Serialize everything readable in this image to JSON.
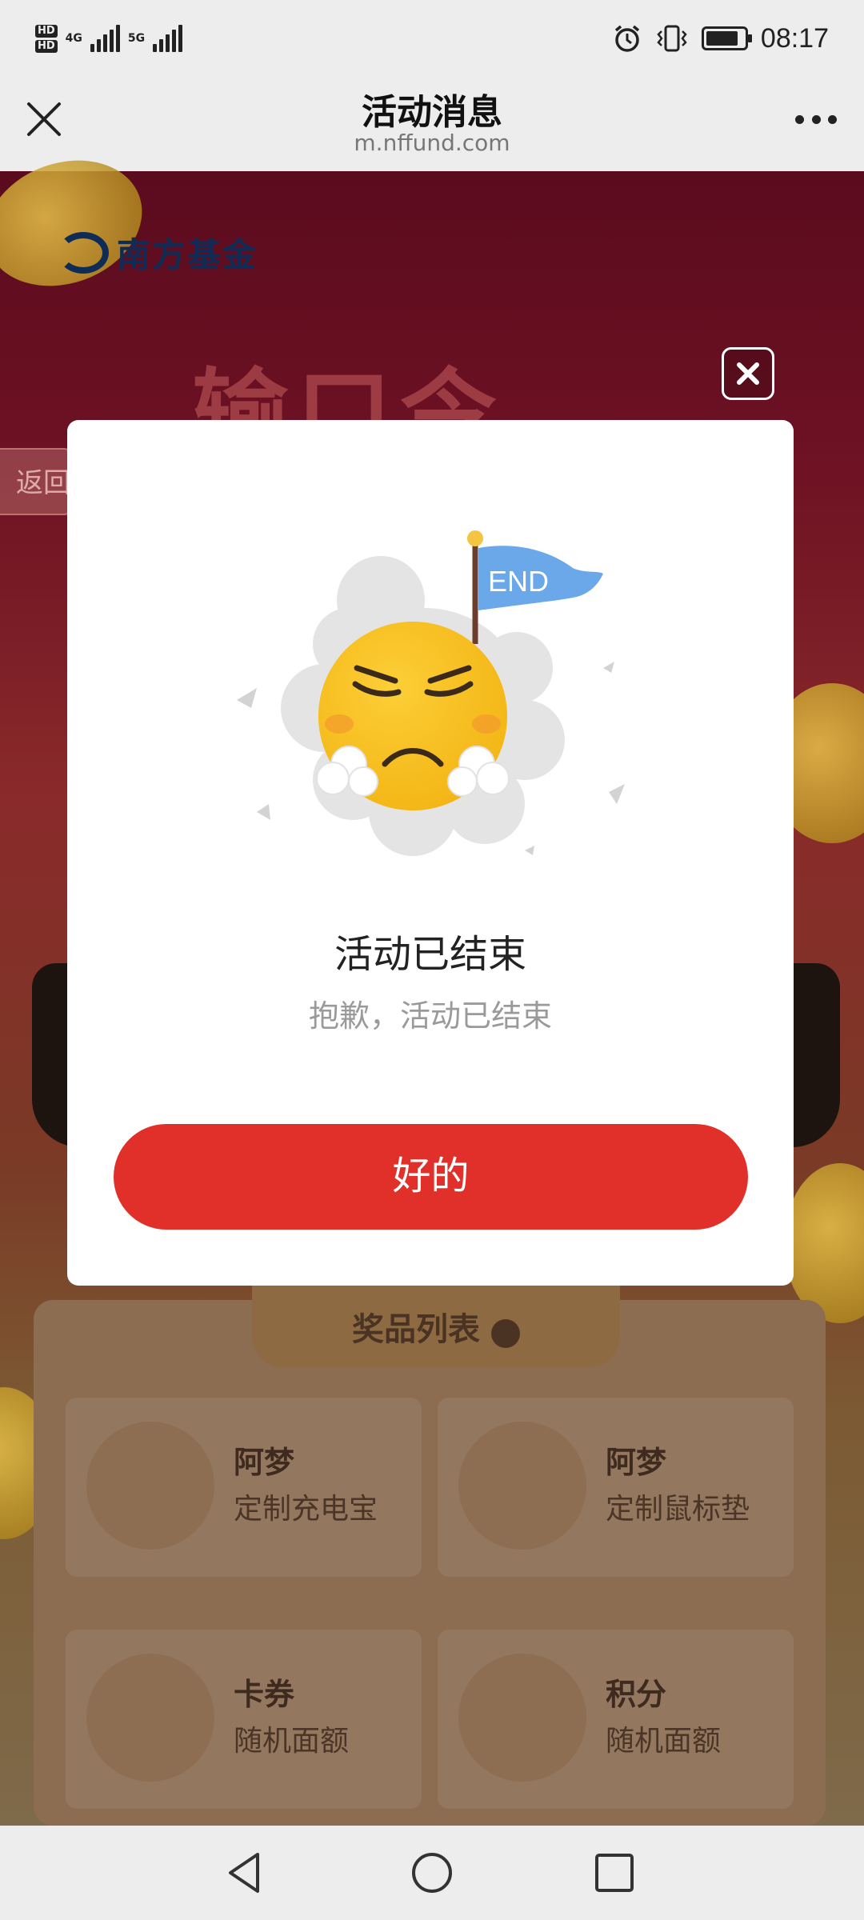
{
  "status_bar": {
    "hd_top": "HD",
    "hd_bottom": "HD",
    "net_4g": "4G",
    "net_5g": "5G",
    "time": "08:17",
    "battery_level": 0.85,
    "icons": [
      "alarm-icon",
      "vibrate-icon",
      "battery-icon"
    ]
  },
  "nav": {
    "title": "活动消息",
    "url": "m.nffund.com",
    "close_icon": "close-icon",
    "more_icon": "more-icon"
  },
  "background_page": {
    "logo_text": "南方基金",
    "banner_text": "输口令",
    "back_label": "返回",
    "prize_header": "奖品列表",
    "prizes": [
      {
        "name": "阿梦",
        "desc": "定制充电宝"
      },
      {
        "name": "阿梦",
        "desc": "定制鼠标垫"
      },
      {
        "name": "卡券",
        "desc": "随机面额"
      },
      {
        "name": "积分",
        "desc": "随机面额"
      }
    ]
  },
  "modal": {
    "flag_text": "END",
    "title": "活动已结束",
    "subtitle": "抱歉，活动已结束",
    "ok_label": "好的"
  },
  "colors": {
    "accent": "#e1302a",
    "flag": "#6aa8ea",
    "emoji": "#f7c21c"
  }
}
